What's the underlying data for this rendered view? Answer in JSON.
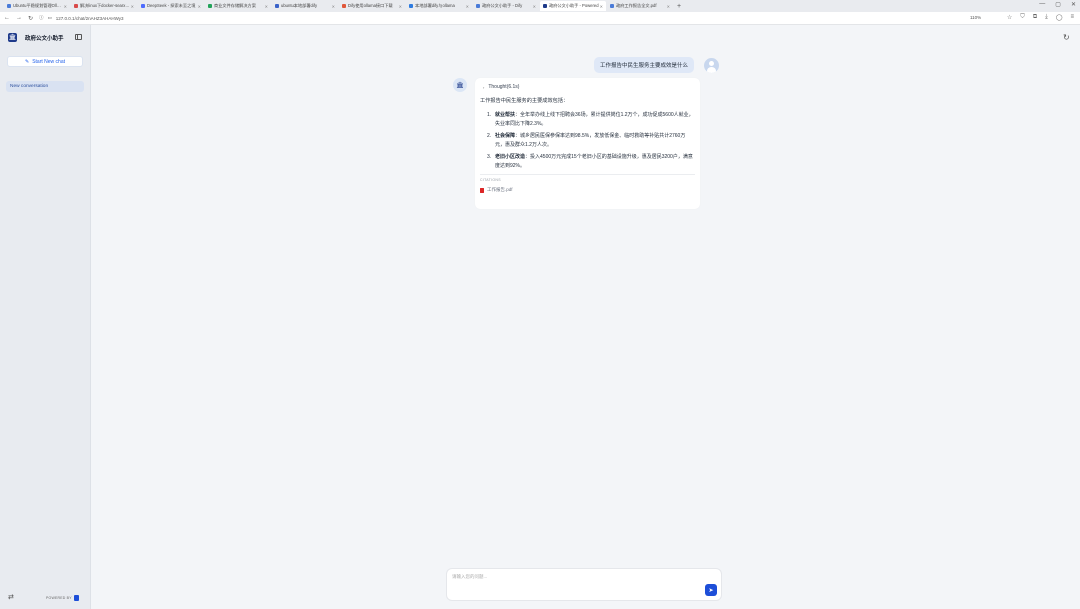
{
  "browser": {
    "tabs": [
      {
        "label": "Ubuntu平稳规划管理Ollama",
        "active": false
      },
      {
        "label": "解决linux下docker-searxng",
        "active": false
      },
      {
        "label": "DeepSeek - 探索未至之境",
        "active": false
      },
      {
        "label": "商业文件存储解决方案",
        "active": false
      },
      {
        "label": "ubuntu本地部署dify",
        "active": false
      },
      {
        "label": "Dify使用ollama接口下载",
        "active": false
      },
      {
        "label": "本地部署dify与ollama",
        "active": false
      },
      {
        "label": "政府公文小助手 - Dify",
        "active": false
      },
      {
        "label": "政府公文小助手 - Powered",
        "active": true
      },
      {
        "label": "政府工作报告全文.pdf",
        "active": false
      }
    ],
    "new_tab": "+",
    "url": "127.0.0.1/chat/2nAHZ3AHAHWy3",
    "zoom": "110%"
  },
  "sidebar": {
    "app_name": "政府公文小助手",
    "new_chat_label": "Start New chat",
    "conversations": [
      "New conversation"
    ],
    "powered_by": "POWERED BY"
  },
  "chat": {
    "user_message": "工作报告中民生服务主要成效是什么",
    "thought_label": "Thought(6.1s)",
    "answer_intro": "工作报告中民生服务的主要成效包括：",
    "answer_items": [
      {
        "num": "1.",
        "title": "就业帮扶",
        "text": "：全年举办线上线下招聘会36场，累计提供岗位1.2万个，成功促成5600人就业，失业率同比下降2.3%。"
      },
      {
        "num": "2.",
        "title": "社会保障",
        "text": "：城乡居民医保参保率达到98.5%，发放低保金、临时救助等补贴共计2760万元，惠及群众1.2万人次。"
      },
      {
        "num": "3.",
        "title": "老旧小区改造",
        "text": "：投入4500万元完成15个老旧小区的基础设施升级，惠及居民3200户，满意度达到92%。"
      }
    ],
    "citations_label": "CITATIONS",
    "citation_file": "工作报告.pdf"
  },
  "input": {
    "placeholder": "请输入您的问题..."
  },
  "colors": {
    "accent": "#1d4ed8",
    "sidebar_bg": "#e8ebf0",
    "user_bubble": "#dfe8f7"
  }
}
